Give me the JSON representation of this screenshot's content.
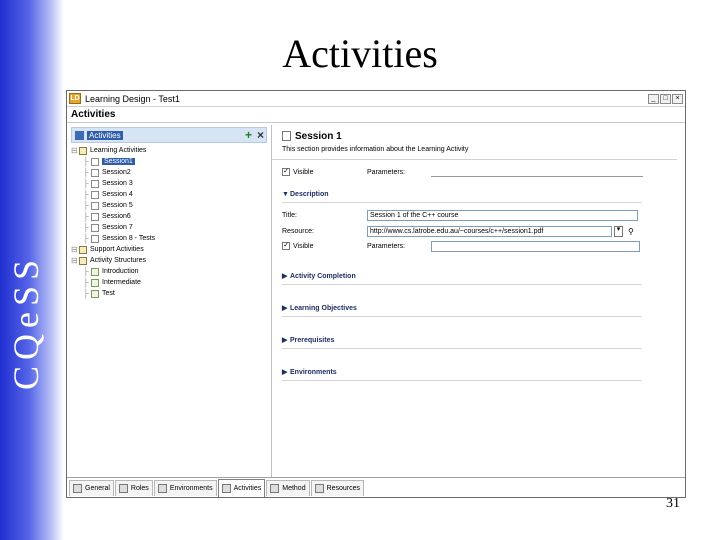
{
  "slide": {
    "title": "Activities",
    "side_logo": "CQeSS",
    "page_number": "31"
  },
  "window": {
    "app_icon_text": "LD",
    "title": "Learning Design - Test1",
    "buttons": [
      "_",
      "□",
      "×"
    ]
  },
  "editor": {
    "header": "Activities"
  },
  "tree": {
    "header": "Activities",
    "items": [
      {
        "label": "Learning Activities",
        "indent": 0,
        "icon": "folder"
      },
      {
        "label": "Session1",
        "indent": 1,
        "icon": "page",
        "selected": true
      },
      {
        "label": "Session2",
        "indent": 1,
        "icon": "page"
      },
      {
        "label": "Session 3",
        "indent": 1,
        "icon": "page"
      },
      {
        "label": "Session 4",
        "indent": 1,
        "icon": "page"
      },
      {
        "label": "Session 5",
        "indent": 1,
        "icon": "page"
      },
      {
        "label": "Session6",
        "indent": 1,
        "icon": "page"
      },
      {
        "label": "Session 7",
        "indent": 1,
        "icon": "page"
      },
      {
        "label": "Session 8 - Tests",
        "indent": 1,
        "icon": "page"
      },
      {
        "label": "Support Activities",
        "indent": 0,
        "icon": "folder"
      },
      {
        "label": "Activity Structures",
        "indent": 0,
        "icon": "folder"
      },
      {
        "label": "Introduction",
        "indent": 1,
        "icon": "struct"
      },
      {
        "label": "Intermediate",
        "indent": 1,
        "icon": "struct"
      },
      {
        "label": "Test",
        "indent": 1,
        "icon": "struct"
      }
    ]
  },
  "detail": {
    "title": "Session 1",
    "description": "This section provides information about the Learning Activity",
    "visible_label": "Visible",
    "visible_checked": "✓",
    "parameters_label": "Parameters:",
    "description_section": "Description",
    "title_label": "Title:",
    "title_value": "Session 1 of the C++ course",
    "resource_label": "Resource:",
    "resource_value": "http://www.cs.latrobe.edu.au/~courses/c++/session1.pdf",
    "visible2_label": "Visible",
    "parameters2_label": "Parameters:",
    "collapsed_sections": [
      "Activity Completion",
      "Learning Objectives",
      "Prerequisites",
      "Environments"
    ]
  },
  "tabs": [
    {
      "label": "General",
      "active": false
    },
    {
      "label": "Roles",
      "active": false
    },
    {
      "label": "Environments",
      "active": false
    },
    {
      "label": "Activities",
      "active": true
    },
    {
      "label": "Method",
      "active": false
    },
    {
      "label": "Resources",
      "active": false
    }
  ]
}
